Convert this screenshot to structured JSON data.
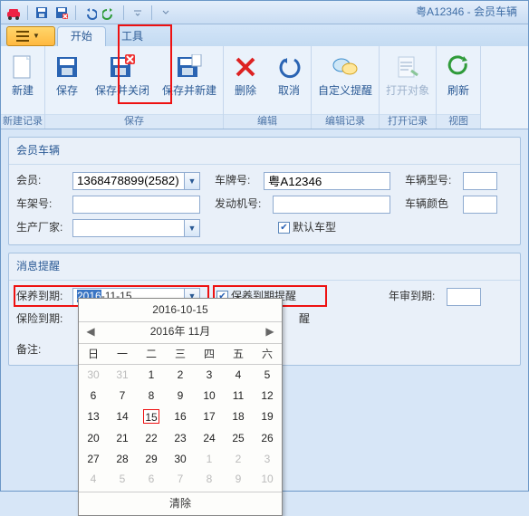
{
  "window_title": "粤A12346 - 会员车辆",
  "tabs": {
    "file_icon": "list",
    "start": "开始",
    "tools": "工具"
  },
  "ribbon": {
    "group_newrecord": "新建记录",
    "group_save": "保存",
    "group_edit": "编辑",
    "group_editrecord": "编辑记录",
    "group_openrecord": "打开记录",
    "group_view": "视图",
    "new": "新建",
    "save": "保存",
    "save_close": "保存并关闭",
    "save_new": "保存并新建",
    "delete": "删除",
    "cancel": "取消",
    "custom_remind": "自定义提醒",
    "open_obj": "打开对象",
    "refresh": "刷新"
  },
  "panel1": {
    "title": "会员车辆",
    "member_label": "会员:",
    "member_value": "1368478899(2582)",
    "plate_label": "车牌号:",
    "plate_value": "粤A12346",
    "model_label": "车辆型号:",
    "vin_label": "车架号:",
    "engine_label": "发动机号:",
    "color_label": "车辆颜色",
    "mfr_label": "生产厂家:",
    "default_model": "默认车型"
  },
  "panel2": {
    "title": "消息提醒",
    "maint_label": "保养到期:",
    "maint_value_sel": "2016",
    "maint_value_rest": "-11-15",
    "maint_remind": "保养到期提醒",
    "annual_label": "年审到期:",
    "insure_label": "保险到期:",
    "insure_remind_suffix": "醒",
    "remark_label": "备注:"
  },
  "calendar": {
    "header_date": "2016-10-15",
    "month_label": "2016年 11月",
    "days": [
      "日",
      "一",
      "二",
      "三",
      "四",
      "五",
      "六"
    ],
    "weeks": [
      [
        {
          "v": "30",
          "o": 1
        },
        {
          "v": "31",
          "o": 1
        },
        {
          "v": "1"
        },
        {
          "v": "2"
        },
        {
          "v": "3"
        },
        {
          "v": "4"
        },
        {
          "v": "5"
        }
      ],
      [
        {
          "v": "6"
        },
        {
          "v": "7"
        },
        {
          "v": "8"
        },
        {
          "v": "9"
        },
        {
          "v": "10"
        },
        {
          "v": "11"
        },
        {
          "v": "12"
        }
      ],
      [
        {
          "v": "13"
        },
        {
          "v": "14"
        },
        {
          "v": "15",
          "s": 1
        },
        {
          "v": "16"
        },
        {
          "v": "17"
        },
        {
          "v": "18"
        },
        {
          "v": "19"
        }
      ],
      [
        {
          "v": "20"
        },
        {
          "v": "21"
        },
        {
          "v": "22"
        },
        {
          "v": "23"
        },
        {
          "v": "24"
        },
        {
          "v": "25"
        },
        {
          "v": "26"
        }
      ],
      [
        {
          "v": "27"
        },
        {
          "v": "28"
        },
        {
          "v": "29"
        },
        {
          "v": "30"
        },
        {
          "v": "1",
          "o": 1
        },
        {
          "v": "2",
          "o": 1
        },
        {
          "v": "3",
          "o": 1
        }
      ],
      [
        {
          "v": "4",
          "o": 1
        },
        {
          "v": "5",
          "o": 1
        },
        {
          "v": "6",
          "o": 1
        },
        {
          "v": "7",
          "o": 1
        },
        {
          "v": "8",
          "o": 1
        },
        {
          "v": "9",
          "o": 1
        },
        {
          "v": "10",
          "o": 1
        }
      ]
    ],
    "clear": "清除"
  }
}
